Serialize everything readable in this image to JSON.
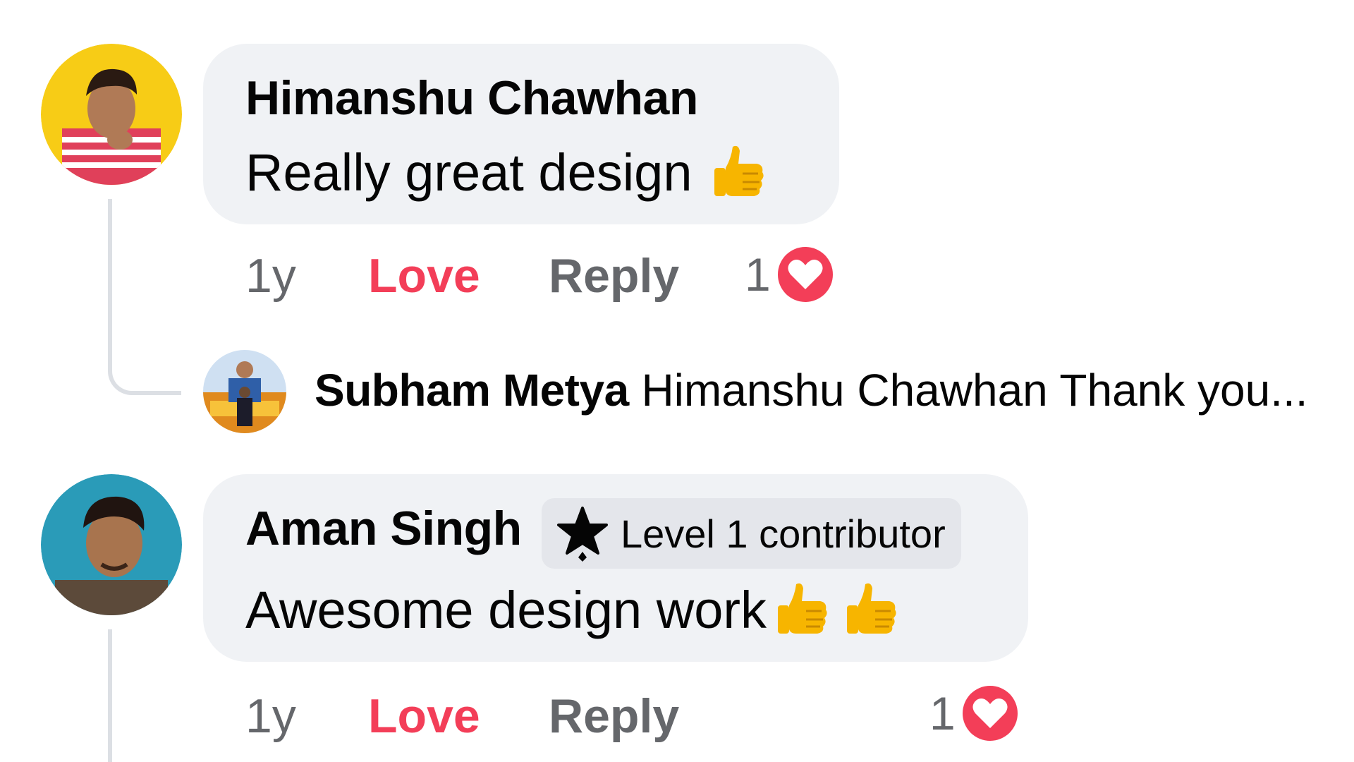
{
  "comments": [
    {
      "author": "Himanshu Chawhan",
      "text": "Really great design",
      "emoji": [
        "thumbs-up"
      ],
      "time": "1y",
      "love_label": "Love",
      "reply_label": "Reply",
      "reaction_count": "1",
      "reaction_icon": "heart-icon",
      "avatar_bg": "#f7cc16"
    },
    {
      "author": "Aman Singh",
      "badge": "Level 1 contributor",
      "badge_icon": "star-badge-icon",
      "text": "Awesome design work",
      "emoji": [
        "thumbs-up",
        "thumbs-up"
      ],
      "time": "1y",
      "love_label": "Love",
      "reply_label": "Reply",
      "reaction_count": "1",
      "reaction_icon": "heart-icon",
      "avatar_bg": "#2a9bb8"
    }
  ],
  "reply": {
    "author": "Subham Metya",
    "preview": "Himanshu Chawhan Thank you..."
  },
  "colors": {
    "bubble": "#f0f2f5",
    "love": "#f33e58",
    "muted": "#65676b",
    "badge": "#e4e6eb",
    "thread_line": "#dcdfe4"
  }
}
